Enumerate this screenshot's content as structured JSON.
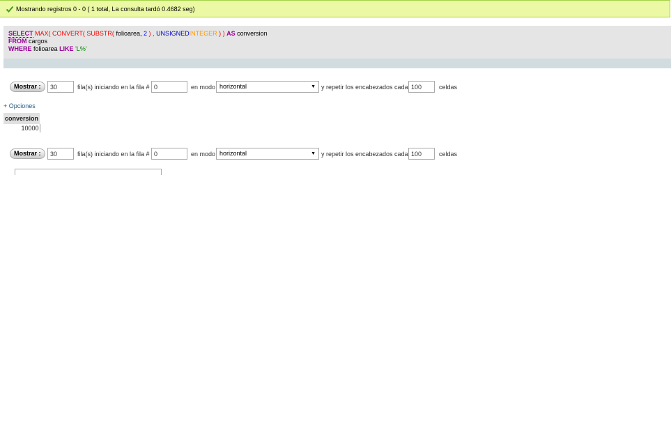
{
  "success": {
    "message": "Mostrando registros 0 - 0 ( 1 total, La consulta tardó 0.4682 seg)",
    "icon": "check-icon",
    "color": "#ebf8a4"
  },
  "sql": {
    "line1": {
      "select": "SELECT",
      "max": "MAX(",
      "convert": "CONVERT(",
      "substr": "SUBSTR(",
      "col": "folioarea,",
      "num": "2",
      "close1": ")",
      "comma": ",",
      "unsigned": "UNSIGNED",
      "integer": "INTEGER",
      "close2": ") )",
      "as": "AS",
      "alias": "conversion"
    },
    "line2": {
      "from": "FROM",
      "table": "cargos"
    },
    "line3": {
      "where": "WHERE",
      "col": "folioarea",
      "like": "LIKE",
      "value": "'L%'"
    }
  },
  "nav_top": {
    "button": "Mostrar :",
    "rows_value": "30",
    "label_rows": "fila(s) iniciando en la fila #",
    "start_value": "0",
    "label_mode": "en modo",
    "mode_value": "horizontal",
    "label_repeat": "y repetir los encabezados cada",
    "repeat_value": "100",
    "label_cells": "celdas"
  },
  "nav_bottom": {
    "button": "Mostrar :",
    "rows_value": "30",
    "label_rows": "fila(s) iniciando en la fila #",
    "start_value": "0",
    "label_mode": "en modo",
    "mode_value": "horizontal",
    "label_repeat": "y repetir los encabezados cada",
    "repeat_value": "100",
    "label_cells": "celdas"
  },
  "options_link": "+ Opciones",
  "table": {
    "header": "conversion",
    "rows": [
      "10000"
    ]
  }
}
